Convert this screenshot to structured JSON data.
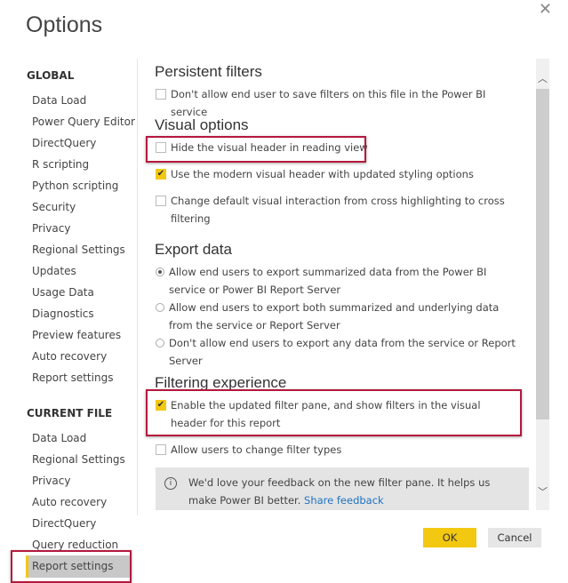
{
  "dialog": {
    "title": "Options",
    "close_icon": "close-icon"
  },
  "nav": {
    "global_heading": "GLOBAL",
    "global_items": [
      "Data Load",
      "Power Query Editor",
      "DirectQuery",
      "R scripting",
      "Python scripting",
      "Security",
      "Privacy",
      "Regional Settings",
      "Updates",
      "Usage Data",
      "Diagnostics",
      "Preview features",
      "Auto recovery",
      "Report settings"
    ],
    "current_heading": "CURRENT FILE",
    "current_items": [
      "Data Load",
      "Regional Settings",
      "Privacy",
      "Auto recovery",
      "DirectQuery",
      "Query reduction",
      "Report settings"
    ],
    "selected": "Report settings"
  },
  "content": {
    "persistent": {
      "heading": "Persistent filters",
      "option": "Don't allow end user to save filters on this file in the Power BI service",
      "checked": false
    },
    "visual": {
      "heading": "Visual options",
      "options": [
        {
          "label": "Hide the visual header in reading view",
          "checked": false
        },
        {
          "label": "Use the modern visual header with updated styling options",
          "checked": true
        },
        {
          "label": "Change default visual interaction from cross highlighting to cross filtering",
          "checked": false
        }
      ]
    },
    "export": {
      "heading": "Export data",
      "options": [
        {
          "label": "Allow end users to export summarized data from the Power BI service or Power BI Report Server",
          "selected": true
        },
        {
          "label": "Allow end users to export both summarized and underlying data from the service or Report Server",
          "selected": false
        },
        {
          "label": "Don't allow end users to export any data from the service or Report Server",
          "selected": false
        }
      ]
    },
    "filtering": {
      "heading": "Filtering experience",
      "options": [
        {
          "label": "Enable the updated filter pane, and show filters in the visual header for this report",
          "checked": true
        },
        {
          "label": "Allow users to change filter types",
          "checked": false
        }
      ]
    },
    "info": {
      "text": "We'd love your feedback on the new filter pane. It helps us make Power BI better.",
      "link": "Share feedback"
    }
  },
  "buttons": {
    "ok": "OK",
    "cancel": "Cancel"
  },
  "colors": {
    "accent": "#f2c811",
    "highlight": "#b5183d",
    "link": "#1f72c4"
  }
}
